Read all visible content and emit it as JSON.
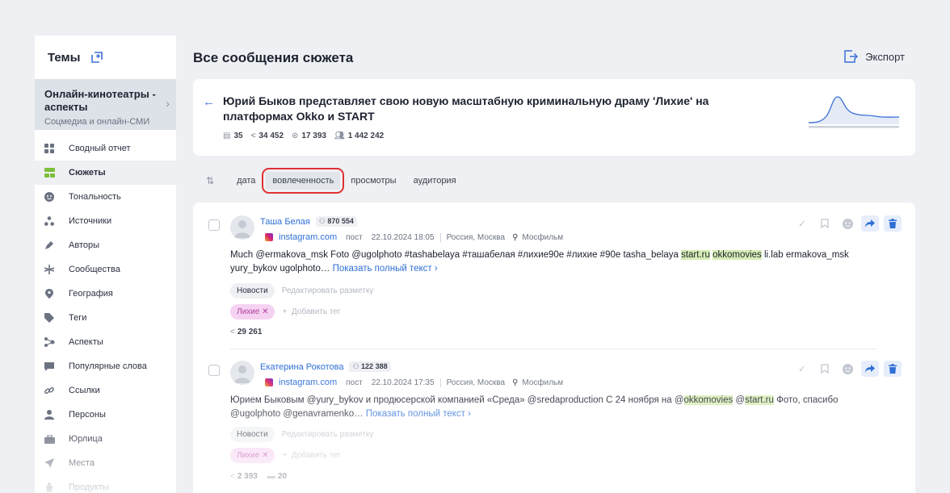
{
  "sidebar": {
    "title": "Темы",
    "topic": {
      "name": "Онлайн-кинотеатры - аспекты",
      "subtitle": "Соцмедиа и онлайн-СМИ"
    },
    "items": [
      {
        "label": "Сводный отчет",
        "icon": "grid-icon"
      },
      {
        "label": "Сюжеты",
        "icon": "stories-icon",
        "active": true
      },
      {
        "label": "Тональность",
        "icon": "smile-icon"
      },
      {
        "label": "Источники",
        "icon": "sources-icon"
      },
      {
        "label": "Авторы",
        "icon": "pen-icon"
      },
      {
        "label": "Сообщества",
        "icon": "communities-icon"
      },
      {
        "label": "География",
        "icon": "location-pin-icon"
      },
      {
        "label": "Теги",
        "icon": "tag-icon"
      },
      {
        "label": "Аспекты",
        "icon": "aspects-icon"
      },
      {
        "label": "Популярные слова",
        "icon": "chat-icon"
      },
      {
        "label": "Ссылки",
        "icon": "link-icon"
      },
      {
        "label": "Персоны",
        "icon": "person-icon"
      },
      {
        "label": "Юрлица",
        "icon": "briefcase-icon"
      },
      {
        "label": "Места",
        "icon": "navigation-icon"
      },
      {
        "label": "Продукты",
        "icon": "product-icon"
      }
    ]
  },
  "main": {
    "title": "Все сообщения сюжета",
    "export_label": "Экспорт",
    "story": {
      "title": "Юрий Быков представляет свою новую масштабную криминальную драму 'Лихие' на платформах Okko и START",
      "stats": {
        "messages": "35",
        "shares": "34 452",
        "views": "17 393",
        "audience": "1 442 242"
      }
    },
    "sort": {
      "options": [
        "дата",
        "вовлеченность",
        "просмотры",
        "аудитория"
      ],
      "selected": "вовлеченность"
    }
  },
  "posts": [
    {
      "author": "Таша Белая",
      "subscribers": "870 554",
      "source": "instagram.com",
      "type": "пост",
      "datetime": "22.10.2024 18:05",
      "region": "Россия, Москва",
      "place": "Мосфильм",
      "text_parts": {
        "a": "Much @ermakova_msk Foto @ugolphoto #tashabelaya #ташабелая #лихие90е #лихие #90е tasha_belaya ",
        "hl1": "start.ru",
        "b": " ",
        "hl2": "okkomovies",
        "c": " li.lab ermakova_msk yury_bykov ugolphoto… "
      },
      "show_more": "Показать полный текст ›",
      "category": "Новости",
      "edit_markup": "Редактировать разметку",
      "tag": "Лихие",
      "add_tag": "Добавить тег",
      "shares": "29 261"
    },
    {
      "author": "Екатерина Рокотова",
      "subscribers": "122 388",
      "source": "instagram.com",
      "type": "пост",
      "datetime": "22.10.2024 17:35",
      "region": "Россия, Москва",
      "place": "Мосфильм",
      "text_parts": {
        "a": "Юрием Быковым @yury_bykov и продюсерской компанией «Среда» @sredaproduction С 24 ноября на @",
        "hl1": "okkomovies",
        "b": " @",
        "hl2": "start.ru",
        "c": " Фото, спасибо @ugolphoto @genavramenko… "
      },
      "show_more": "Показать полный текст ›",
      "category": "Новости",
      "edit_markup": "Редактировать разметку",
      "tag": "Лихие",
      "add_tag": "Добавить тег",
      "shares": "2 393",
      "comments": "20"
    }
  ],
  "colors": {
    "accent": "#3b6fd8",
    "highlight": "#d6edb4",
    "tag_pink": "#f6d2f2",
    "active_icon": "#7bbf3a",
    "selection_box": "#e03131"
  }
}
